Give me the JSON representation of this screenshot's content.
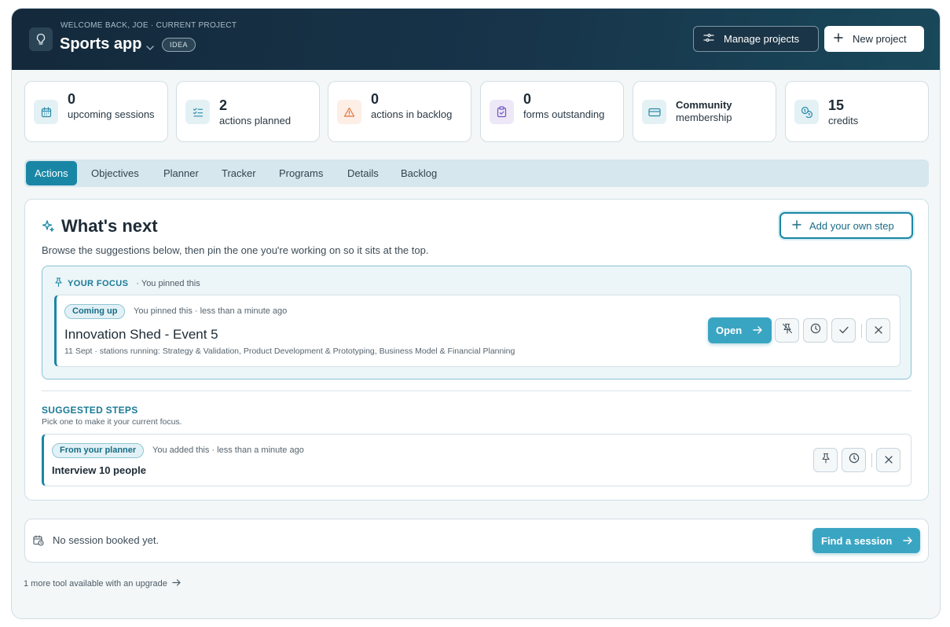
{
  "header": {
    "welcome": "WELCOME BACK, JOE · CURRENT PROJECT",
    "project_name": "Sports app",
    "stage_badge": "IDEA",
    "manage_label": "Manage projects",
    "new_label": "New project",
    "icons": [
      "lightbulb-icon",
      "chevron-down-icon",
      "sliders-icon",
      "plus-icon"
    ]
  },
  "stats": [
    {
      "num": "0",
      "label": "upcoming sessions",
      "icon": "calendar-icon",
      "color": "#e3f1f5"
    },
    {
      "num": "2",
      "label": "actions planned",
      "icon": "checklist-icon",
      "color": "#e3f1f5"
    },
    {
      "num": "0",
      "label": "actions in backlog",
      "icon": "warning-icon",
      "color": "#fdeee6"
    },
    {
      "num": "0",
      "label": "forms outstanding",
      "icon": "clipboard-check-icon",
      "color": "#ece8f7"
    },
    {
      "title": "Community",
      "label": "membership",
      "icon": "credit-card-icon",
      "color": "#e3f1f5"
    },
    {
      "num": "15",
      "label": "credits",
      "icon": "coins-icon",
      "color": "#e3f1f5"
    }
  ],
  "tabs": [
    "Actions",
    "Objectives",
    "Planner",
    "Tracker",
    "Programs",
    "Details",
    "Backlog"
  ],
  "active_tab": "Actions",
  "whats_next": {
    "title": "What's next",
    "description": "Browse the suggestions below, then pin the one you're working on so it sits at the top.",
    "add_step_label": "Add your own step"
  },
  "focus": {
    "heading": "YOUR FOCUS",
    "heading_note": "· You pinned this",
    "badge": "Coming up",
    "meta": "You pinned this · less than a minute ago",
    "title": "Innovation Shed - Event 5",
    "subtitle": "11 Sept · stations running: Strategy & Validation, Product Development & Prototyping, Business Model & Financial Planning",
    "open_label": "Open"
  },
  "suggested": {
    "heading": "SUGGESTED STEPS",
    "subheading": "Pick one to make it your current focus.",
    "items": [
      {
        "badge": "From your planner",
        "meta": "You added this · less than a minute ago",
        "title": "Interview 10 people"
      }
    ]
  },
  "session": {
    "text": "No session booked yet.",
    "find_label": "Find a session"
  },
  "upgrade_text": "1 more tool available with an upgrade",
  "colors": {
    "accent": "#1a86a6",
    "header_dark": "#14293b",
    "primary_button": "#3aa5c3"
  }
}
